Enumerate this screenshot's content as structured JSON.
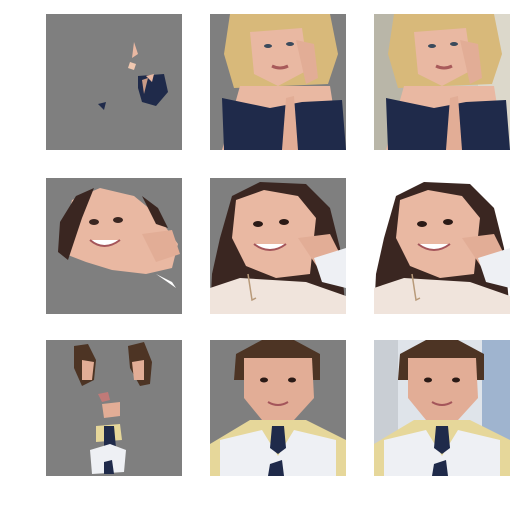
{
  "figure": {
    "rows": [
      {
        "subject": "blonde-woman-lace-top",
        "panels": [
          "masked",
          "segmented",
          "original"
        ]
      },
      {
        "subject": "smiling-girl-hand-on-cheek",
        "panels": [
          "masked",
          "segmented",
          "original"
        ]
      },
      {
        "subject": "boy-sweater-vest",
        "panels": [
          "masked",
          "segmented",
          "original"
        ]
      }
    ],
    "colors": {
      "mask_gray": "#7f7f7f",
      "background": "#ffffff",
      "skin": "#e9b8a2",
      "blonde_hair": "#d8b97a",
      "dark_hair": "#3a2621",
      "brown_hair": "#4d3424",
      "navy_lace": "#1f2a4a",
      "white_clothes": "#eef0f4",
      "yellow_shirt": "#e6d79a"
    }
  }
}
